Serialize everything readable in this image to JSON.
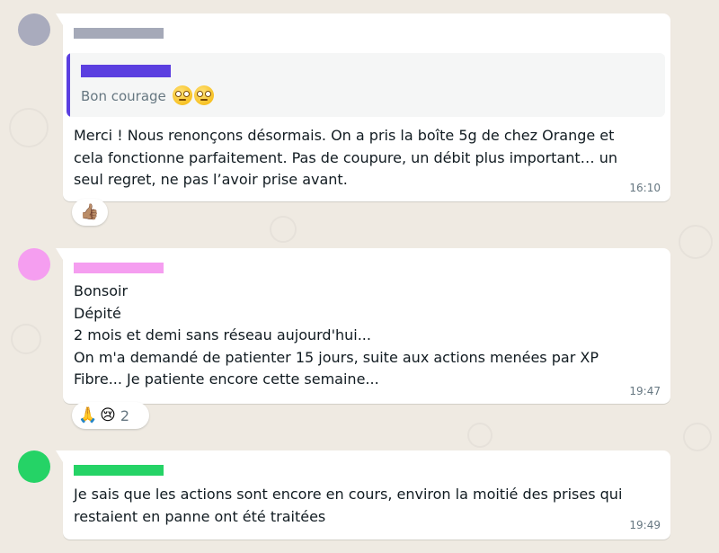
{
  "colors": {
    "chat_background": "#efeae2",
    "bubble": "#ffffff",
    "timestamp": "#667781",
    "text": "#111b21"
  },
  "messages": [
    {
      "avatar_color": "#a9abbd",
      "name_bar_color": "#a5a9b8",
      "quote": {
        "author_bar_color": "#5b3fe0",
        "text": "Bon courage",
        "emojis": [
          "face-with-rolling-eyes",
          "face-with-rolling-eyes"
        ]
      },
      "text": "Merci ! Nous renonçons désormais. On a pris la boîte 5g de chez Orange et\ncela fonctionne parfaitement. Pas de coupure, un débit plus important… un\nseul regret, ne pas l’avoir prise avant.",
      "time": "16:10",
      "reactions": {
        "emojis": [
          "👍🏽"
        ],
        "count": ""
      }
    },
    {
      "avatar_color": "#f59ef0",
      "name_bar_color": "#f59ef0",
      "text": "Bonsoir\nDépité\n2 mois et demi sans réseau aujourd'hui...\nOn m'a demandé de patienter 15 jours, suite aux actions menées par XP\nFibre... Je patiente encore cette semaine...",
      "time": "19:47",
      "reactions": {
        "emojis": [
          "🙏",
          "😢"
        ],
        "count": "2"
      }
    },
    {
      "avatar_color": "#25d366",
      "name_bar_color": "#25d366",
      "text": "Je sais que les actions sont encore en cours, environ la moitié des prises qui\nrestaient en panne ont été traitées",
      "time": "19:49"
    }
  ]
}
